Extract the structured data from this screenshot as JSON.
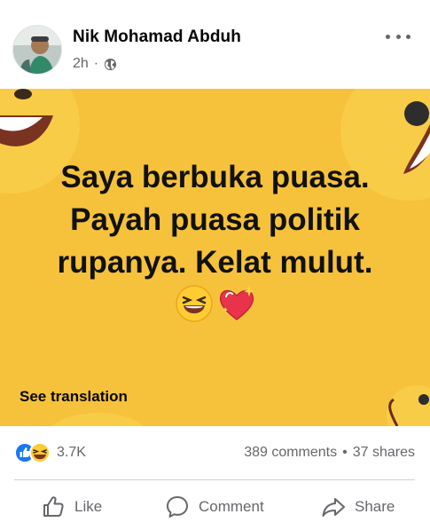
{
  "header": {
    "author": "Nik Mohamad Abduh",
    "time": "2h",
    "separator": "·",
    "privacy_icon": "globe-icon",
    "more_icon": "more-options-icon"
  },
  "post": {
    "text": "Saya berbuka puasa.\nPayah puasa politik\nrupanya. Kelat mulut.",
    "emojis": [
      "grinning-squinting-face",
      "sparkling-heart"
    ],
    "background_color": "#f6c23b",
    "see_translation": "See translation"
  },
  "stats": {
    "reactions": [
      "like",
      "haha"
    ],
    "reaction_count": "3.7K",
    "comments": "389 comments",
    "dot": "•",
    "shares": "37 shares"
  },
  "actions": {
    "like": "Like",
    "comment": "Comment",
    "share": "Share"
  },
  "colors": {
    "text_primary": "#050505",
    "text_secondary": "#65676b",
    "like_blue": "#1877f2",
    "yellow": "#f6c23b"
  }
}
